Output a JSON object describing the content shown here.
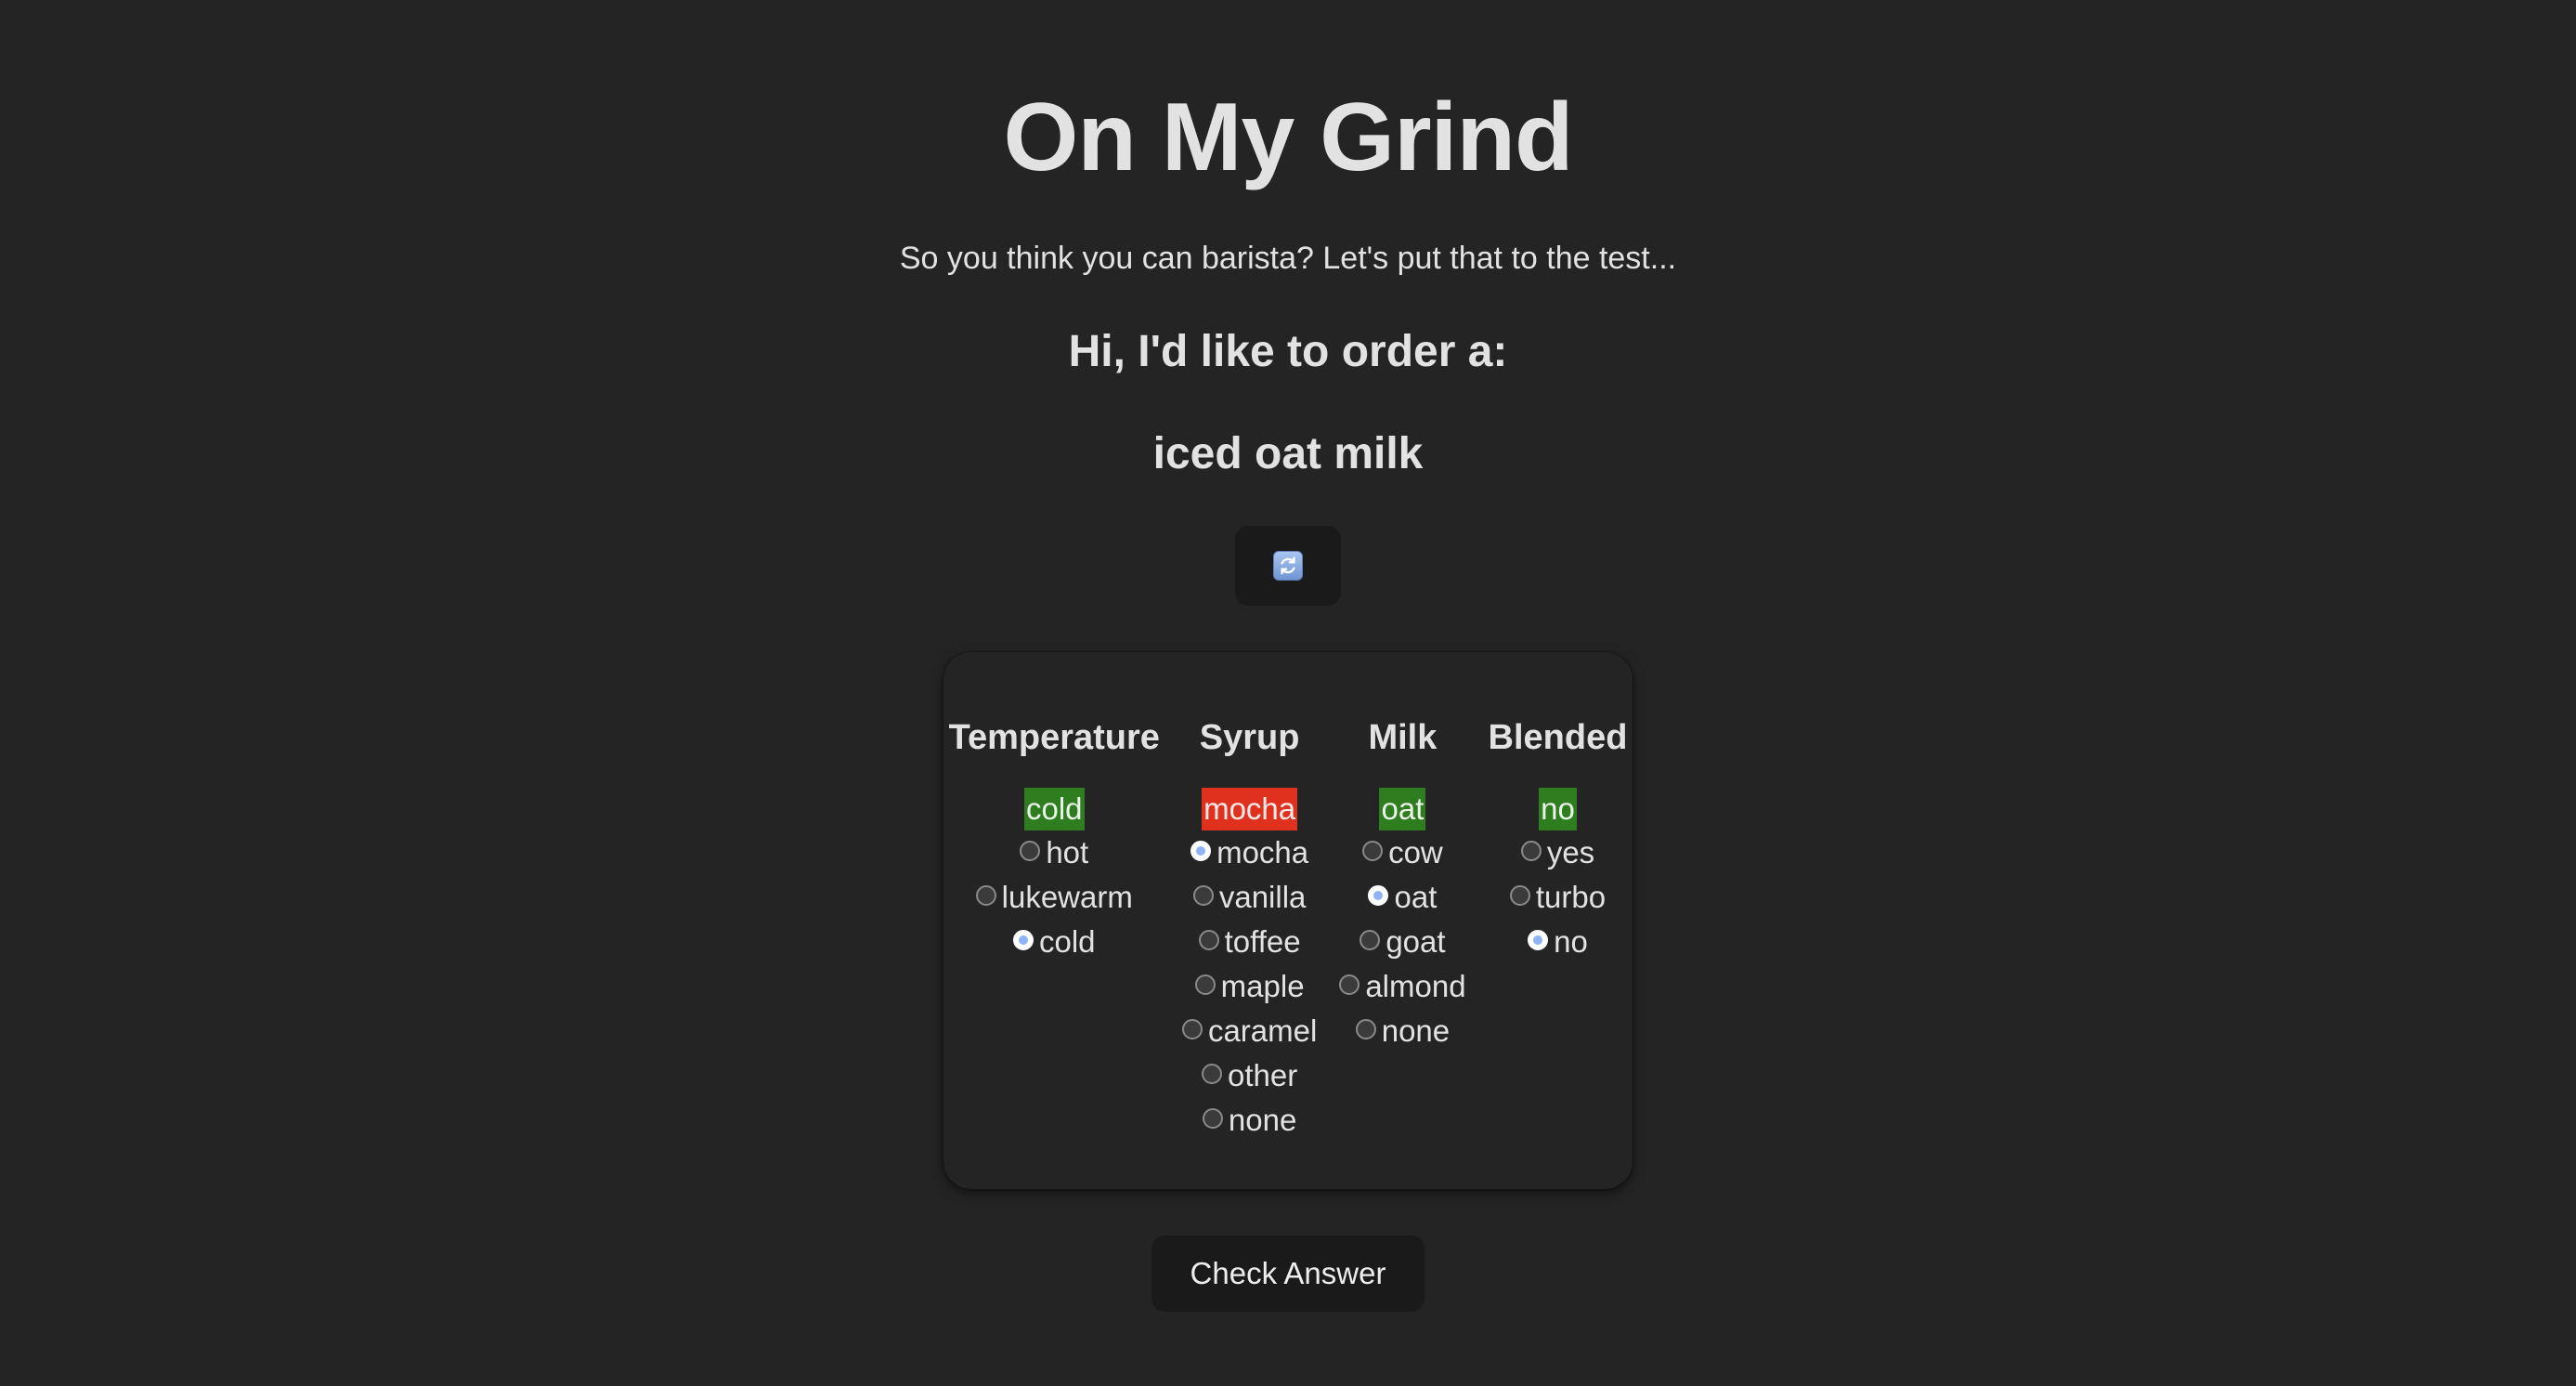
{
  "header": {
    "title": "On My Grind",
    "tagline": "So you think you can barista? Let's put that to the test...",
    "order_prompt": "Hi, I'd like to order a:",
    "order_item": "iced oat milk"
  },
  "refresh_button": {
    "icon": "refresh-icon"
  },
  "quiz": {
    "columns": [
      {
        "key": "temperature",
        "heading": "Temperature",
        "answer": "cold",
        "answer_status": "correct",
        "options": [
          "hot",
          "lukewarm",
          "cold"
        ],
        "selected": "cold"
      },
      {
        "key": "syrup",
        "heading": "Syrup",
        "answer": "mocha",
        "answer_status": "wrong",
        "options": [
          "mocha",
          "vanilla",
          "toffee",
          "maple",
          "caramel",
          "other",
          "none"
        ],
        "selected": "mocha"
      },
      {
        "key": "milk",
        "heading": "Milk",
        "answer": "oat",
        "answer_status": "correct",
        "options": [
          "cow",
          "oat",
          "goat",
          "almond",
          "none"
        ],
        "selected": "oat"
      },
      {
        "key": "blended",
        "heading": "Blended",
        "answer": "no",
        "answer_status": "correct",
        "options": [
          "yes",
          "turbo",
          "no"
        ],
        "selected": "no"
      }
    ]
  },
  "check_button": {
    "label": "Check Answer"
  },
  "colors": {
    "background": "#242424",
    "correct": "#2e7d1f",
    "wrong": "#e0301e",
    "button": "#1a1a1a"
  }
}
